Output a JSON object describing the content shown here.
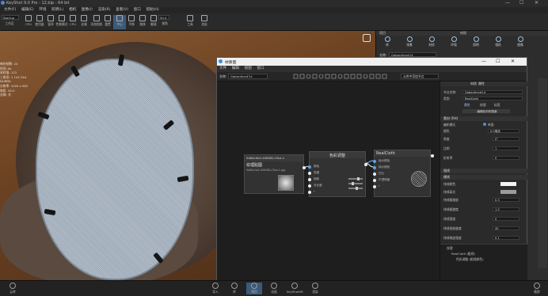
{
  "window": {
    "title": "KeyShot 9.0 Pro - 12.bip - 64 bit"
  },
  "menu": [
    "文件(F)",
    "编辑(E)",
    "环境",
    "照明(L)",
    "相机",
    "图像(I)",
    "渲染(R)",
    "查看(V)",
    "窗口",
    "帮助(H)"
  ],
  "toolbar": {
    "workspace_select": "Startup",
    "items": [
      "工作区",
      "CPU",
      "使用量",
      "暂停",
      "性能模式",
      "CPU",
      "去噪",
      "添加相机",
      "重置",
      "中心",
      "平移",
      "推移",
      "翻滚",
      "视角",
      "工具",
      "渲染"
    ],
    "zoom": "50.0"
  },
  "viewport_stats": [
    "每秒帧数:",
    "时间:",
    "采样值:",
    "三角形:",
    "NURBS:",
    "分辨率:",
    "焦距:",
    "去噪:"
  ],
  "viewport_stat_values": [
    "24",
    "8s",
    "112",
    "1 144 344",
    "",
    "1024 x 602",
    "50.0",
    "关"
  ],
  "rightpanel": {
    "head_left": "项目",
    "head_right": "材质",
    "tabs": [
      "库",
      "场景",
      "材质",
      "环境",
      "照明",
      "相机",
      "图像"
    ],
    "name_label": "名称:",
    "name_value": "Gabardine#14"
  },
  "nodewin": {
    "title": "材质图",
    "menu": [
      "文件",
      "编辑",
      "视图",
      "窗口"
    ],
    "name_label": "名称:",
    "name_value": "Gabardine#14",
    "search": "从库中添加节点",
    "side_head": [
      "材质",
      "属性"
    ],
    "side_name_label": "节点名称:",
    "side_name_value": "Gabardine#14",
    "side_type_label": "类型:",
    "side_type_value": "RealCloth",
    "side_tabs": [
      "属性",
      "纹理",
      "标签"
    ],
    "side_btn": "编辑纺织布图案",
    "section_fabric": "素材 (RH)",
    "rows": [
      {
        "label": "编织模式",
        "value": "单面"
      },
      {
        "label": "颜色",
        "value": "0.0毫米"
      },
      {
        "label": "角度",
        "value": "0°"
      },
      {
        "label": "比例",
        "value": "1"
      },
      {
        "label": "折射率",
        "value": "0"
      }
    ],
    "section_thread": "粗线",
    "section_warp": "横线",
    "warp_rows": [
      {
        "label": "纬线颜色",
        "value": ""
      },
      {
        "label": "纬线高光",
        "value": ""
      },
      {
        "label": "纬线粗糙度",
        "value": "0.3"
      },
      {
        "label": "纬线粗糙度",
        "value": "1.3"
      },
      {
        "label": "纬线宽度",
        "value": "0"
      },
      {
        "label": "纬线扭曲量度",
        "value": "40"
      },
      {
        "label": "纬线噪波强度",
        "value": "0.1"
      }
    ],
    "tree": [
      "纹理",
      "RealCloth (粗线)",
      "色彩调整 (粗线颜色)"
    ],
    "nodes": {
      "texture": {
        "id": "5484c0e2-406581-f3ce-1",
        "title": "纹理贴图",
        "sub": "5484c0e2-406581-f3ce-1.jpg"
      },
      "color": {
        "title": "色彩调整",
        "ports": [
          "颜色",
          "亮度",
          "饱和",
          "对比度",
          "r"
        ]
      },
      "cloth": {
        "title": "RealCloth",
        "ports": [
          "经纱颜色",
          "纬纱颜色",
          "凹凸",
          "不透明度",
          "r"
        ]
      }
    }
  },
  "bottombar": [
    "云库",
    "导入",
    "库",
    "项目",
    "动画",
    "KeyShotXR",
    "渲染",
    "截屏"
  ]
}
